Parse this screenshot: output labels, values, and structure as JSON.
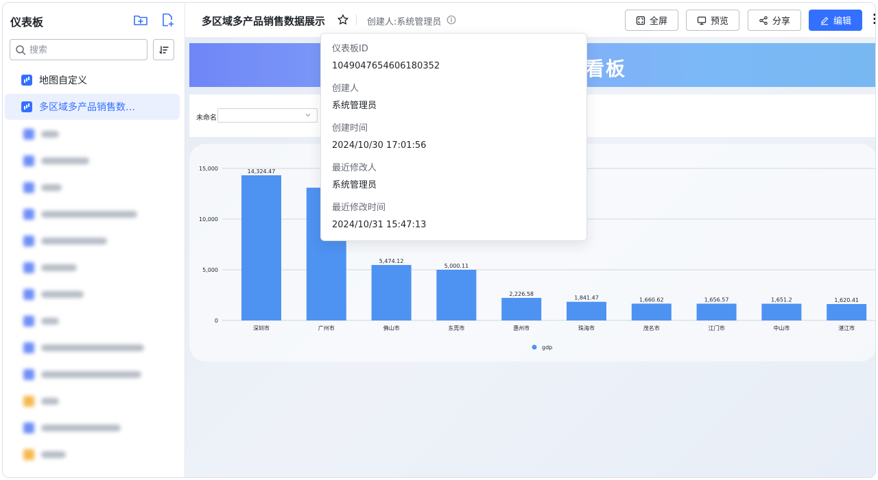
{
  "sidebar": {
    "title": "仪表板",
    "search_placeholder": "搜索",
    "items": [
      {
        "label": "地图自定义",
        "active": false
      },
      {
        "label": "多区域多产品销售数据...",
        "active": true
      }
    ]
  },
  "header": {
    "title": "多区域多产品销售数据展示",
    "creator": "创建人:系统管理员",
    "buttons": {
      "fullscreen": "全屏",
      "preview": "预览",
      "share": "分享",
      "edit": "编辑"
    }
  },
  "dashboard": {
    "banner_title": "看板",
    "filter_label": "未命名"
  },
  "popover": {
    "fields": [
      {
        "label": "仪表板ID",
        "value": "1049047654606180352"
      },
      {
        "label": "创建人",
        "value": "系统管理员"
      },
      {
        "label": "创建时间",
        "value": "2024/10/30 17:01:56"
      },
      {
        "label": "最近修改人",
        "value": "系统管理员"
      },
      {
        "label": "最近修改时间",
        "value": "2024/10/31 15:47:13"
      }
    ]
  },
  "colors": {
    "primary": "#3370ff",
    "bar": "#4e92f2"
  },
  "chart_data": {
    "type": "bar",
    "categories": [
      "深圳市",
      "广州市",
      "佛山市",
      "东莞市",
      "惠州市",
      "珠海市",
      "茂名市",
      "江门市",
      "中山市",
      "湛江市"
    ],
    "series": [
      {
        "name": "gdp",
        "values": [
          14324.47,
          13100,
          5474.12,
          5000.11,
          2226.58,
          1841.47,
          1660.62,
          1656.57,
          1651.2,
          1620.41
        ]
      }
    ],
    "value_labels": [
      "14,324.47",
      "13,1",
      "5,474.12",
      "5,000.11",
      "2,226.58",
      "1,841.47",
      "1,660.62",
      "1,656.57",
      "1,651.2",
      "1,620.41"
    ],
    "yticks": [
      "0",
      "5,000",
      "10,000",
      "15,000"
    ],
    "ylim": [
      0,
      15000
    ],
    "legend": "bottom-center"
  }
}
